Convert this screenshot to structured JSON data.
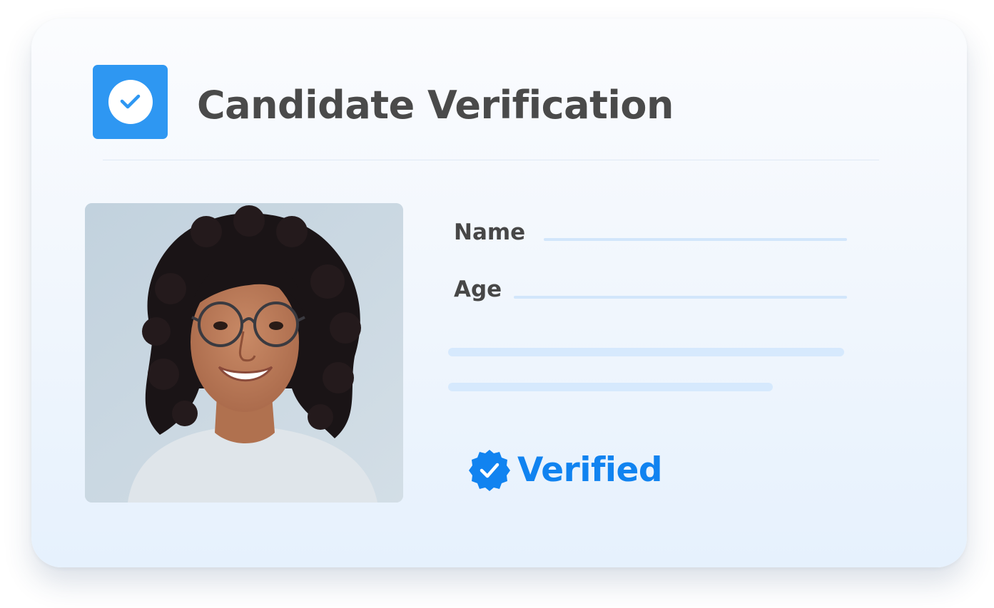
{
  "card": {
    "title": "Candidate Verification",
    "header_icon": "check-circle-icon"
  },
  "candidate": {
    "photo": "candidate-portrait",
    "fields": {
      "name_label": "Name",
      "name_value": "",
      "age_label": "Age",
      "age_value": ""
    }
  },
  "status": {
    "label": "Verified",
    "icon": "verified-badge-icon"
  },
  "colors": {
    "accent": "#2e97f2",
    "verified": "#1183f0",
    "title_text": "#4a4a4a",
    "placeholder": "#d6e9fd"
  }
}
